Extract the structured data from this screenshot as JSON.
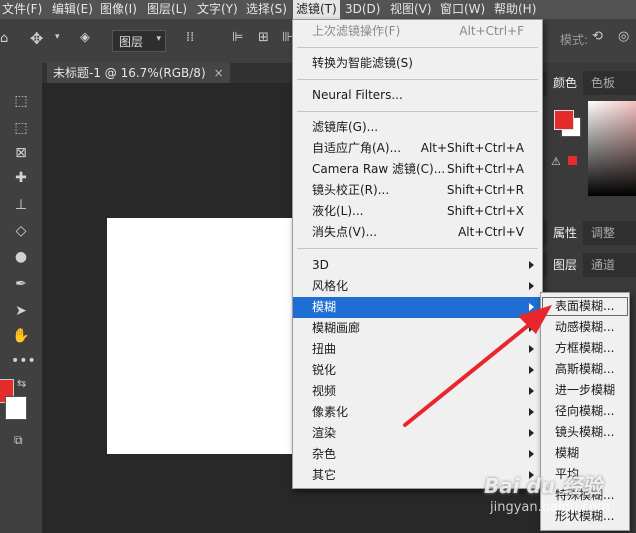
{
  "menubar": {
    "items": [
      "文件(F)",
      "编辑(E)",
      "图像(I)",
      "图层(L)",
      "文字(Y)",
      "选择(S)",
      "滤镜(T)",
      "3D(D)",
      "视图(V)",
      "窗口(W)",
      "帮助(H)"
    ]
  },
  "options_bar": {
    "layer_select": "图层",
    "mode_label": "模式:"
  },
  "document_tab": {
    "title": "未标题-1 @ 16.7%(RGB/8)",
    "close": "×"
  },
  "right_panel": {
    "tabs_top": [
      "颜色",
      "色板"
    ],
    "tabs_mid": [
      "属性",
      "调整"
    ],
    "tabs_bottom": [
      "图层",
      "通道"
    ],
    "fg_color": "#e62b2b"
  },
  "filter_menu": {
    "items": [
      {
        "label": "上次滤镜操作(F)",
        "shortcut": "Alt+Ctrl+F",
        "disabled": true
      },
      {
        "label": "转换为智能滤镜(S)",
        "shortcut": ""
      },
      {
        "label": "Neural Filters...",
        "shortcut": ""
      },
      {
        "label": "滤镜库(G)...",
        "shortcut": ""
      },
      {
        "label": "自适应广角(A)...",
        "shortcut": "Alt+Shift+Ctrl+A"
      },
      {
        "label": "Camera Raw 滤镜(C)...",
        "shortcut": "Shift+Ctrl+A"
      },
      {
        "label": "镜头校正(R)...",
        "shortcut": "Shift+Ctrl+R"
      },
      {
        "label": "液化(L)...",
        "shortcut": "Shift+Ctrl+X"
      },
      {
        "label": "消失点(V)...",
        "shortcut": "Alt+Ctrl+V"
      },
      {
        "label": "3D",
        "submenu": true
      },
      {
        "label": "风格化",
        "submenu": true
      },
      {
        "label": "模糊",
        "submenu": true,
        "highlighted": true
      },
      {
        "label": "模糊画廊",
        "submenu": true
      },
      {
        "label": "扭曲",
        "submenu": true
      },
      {
        "label": "锐化",
        "submenu": true
      },
      {
        "label": "视频",
        "submenu": true
      },
      {
        "label": "像素化",
        "submenu": true
      },
      {
        "label": "渲染",
        "submenu": true
      },
      {
        "label": "杂色",
        "submenu": true
      },
      {
        "label": "其它",
        "submenu": true
      }
    ]
  },
  "blur_submenu": {
    "items": [
      "表面模糊...",
      "动感模糊...",
      "方框模糊...",
      "高斯模糊...",
      "进一步模糊",
      "径向模糊...",
      "镜头模糊...",
      "模糊",
      "平均",
      "特殊模糊...",
      "形状模糊..."
    ]
  },
  "watermark": {
    "logo": "Bai du 经验",
    "url": "jingyan.baidu.com"
  },
  "colors": {
    "accent_highlight": "#1f6ed4",
    "annotation_arrow": "#e8262b"
  }
}
